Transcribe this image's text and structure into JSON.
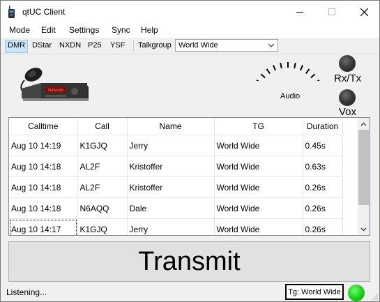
{
  "window": {
    "title": "qtUC Client"
  },
  "menu": [
    "Mode",
    "Edit",
    "Settings",
    "Sync",
    "Help"
  ],
  "toolbar": {
    "modes": [
      "DMR",
      "DStar",
      "NXDN",
      "P25",
      "YSF"
    ],
    "active_mode": "DMR",
    "talkgroup_label": "Talkgroup",
    "talkgroup_value": "World Wide"
  },
  "indicators": {
    "audio_label": "Audio",
    "rxtx_label": "Rx/Tx",
    "vox_label": "Vox"
  },
  "radio_display_text": "Network",
  "table": {
    "columns": [
      "Calltime",
      "Call",
      "Name",
      "TG",
      "Duration"
    ],
    "rows": [
      [
        "Aug 10 14:19",
        "K1GJQ",
        "Jerry",
        "World Wide",
        "0.45s"
      ],
      [
        "Aug 10 14:18",
        "AL2F",
        "Kristoffer",
        "World Wide",
        "0.63s"
      ],
      [
        "Aug 10 14:18",
        "AL2F",
        "Kristoffer",
        "World Wide",
        "0.26s"
      ],
      [
        "Aug 10 14:18",
        "N6AQQ",
        "Dale",
        "World Wide",
        "0.26s"
      ],
      [
        "Aug 10 14:17",
        "K1GJQ",
        "Jerry",
        "World Wide",
        "0.26s"
      ]
    ]
  },
  "transmit_label": "Transmit",
  "status": {
    "text": "Listening...",
    "tg": "Tg: World Wide"
  },
  "colors": {
    "status_led": "#1fd11f",
    "active_mode_bg": "#cce4f7"
  }
}
